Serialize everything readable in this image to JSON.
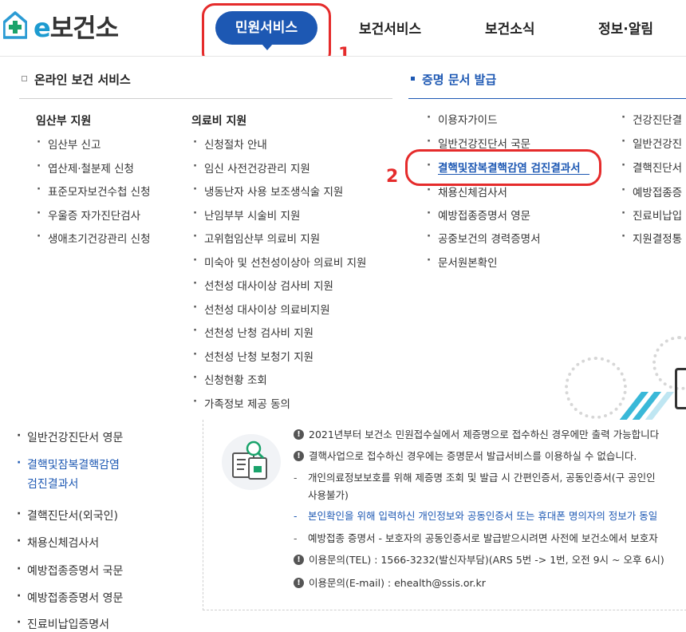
{
  "header": {
    "logo": {
      "e": "e",
      "text": "보건소"
    },
    "nav": [
      "민원서비스",
      "보건서비스",
      "보건소식",
      "정보·알림"
    ]
  },
  "annotations": {
    "num1": "1",
    "num2": "2"
  },
  "mega_menu": {
    "left_section_title": "온라인 보건 서비스",
    "right_section_title": "증명 문서 발급",
    "col1": {
      "title": "임산부 지원",
      "items": [
        "임산부 신고",
        "엽산제·철분제 신청",
        "표준모자보건수첩 신청",
        "우울증 자가진단검사",
        "생애초기건강관리 신청"
      ]
    },
    "col2": {
      "title": "의료비 지원",
      "items": [
        "신청절차 안내",
        "임신 사전건강관리 지원",
        "냉동난자 사용 보조생식술 지원",
        "난임부부 시술비 지원",
        "고위험임산부 의료비 지원",
        "미숙아 및 선천성이상아 의료비 지원",
        "선천성 대사이상 검사비 지원",
        "선천성 대사이상 의료비지원",
        "선천성 난청 검사비 지원",
        "선천성 난청 보청기 지원",
        "신청현황 조회",
        "가족정보 제공 동의"
      ]
    },
    "col3": {
      "items": [
        "이용자가이드",
        "일반건강진단서 국문",
        "결핵및잠복결핵감염 검진결과서",
        "채용신체검사서",
        "예방접종증명서 영문",
        "공중보건의 경력증명서",
        "문서원본확인"
      ]
    },
    "col4": {
      "items": [
        "건강진단결",
        "일반건강진",
        "결핵진단서",
        "예방접종증",
        "진료비납입",
        "지원결정통"
      ]
    }
  },
  "sidebar": {
    "items": [
      {
        "label": "일반건강진단서 영문"
      },
      {
        "label": "결핵및잠복결핵감염",
        "label2": "검진결과서"
      },
      {
        "label": "결핵진단서(외국인)"
      },
      {
        "label": "채용신체검사서"
      },
      {
        "label": "예방접종증명서 국문"
      },
      {
        "label": "예방접종증명서 영문"
      },
      {
        "label": "진료비납입증명서"
      }
    ]
  },
  "notice": {
    "lines": [
      {
        "icon": "info",
        "text": "2021년부터 보건소 민원접수실에서 제증명으로 접수하신 경우에만 출력 가능합니다"
      },
      {
        "icon": "info",
        "text": "결핵사업으로 접수하신 경우에는 증명문서 발급서비스를 이용하실 수 없습니다."
      },
      {
        "icon": "dash",
        "text": "개인의료정보보호를 위해 제증명 조회 및 발급 시 간편인증서, 공동인증서(구 공인인"
      },
      {
        "icon": "none",
        "text": "사용불가)"
      },
      {
        "icon": "dash",
        "text": "본인확인을 위해 입력하신 개인정보와 공동인증서 또는 휴대폰 명의자의 정보가 동일"
      },
      {
        "icon": "dash",
        "text": "예방접종 증명서 - 보호자의 공동인증서로 발급받으시려면 사전에 보건소에서 보호자"
      },
      {
        "icon": "info",
        "text": "이용문의(TEL) : 1566-3232(발신자부담)(ARS 5번 -> 1번, 오전 9시 ~ 오후 6시)"
      },
      {
        "icon": "info",
        "text": "이용문의(E-mail) : ehealth@ssis.or.kr"
      }
    ]
  },
  "colors": {
    "brand_blue": "#1d58b3",
    "logo_green": "#1aa36b",
    "annotation_red": "#e52b2b",
    "stripe_cyan": "#39b8d8"
  }
}
